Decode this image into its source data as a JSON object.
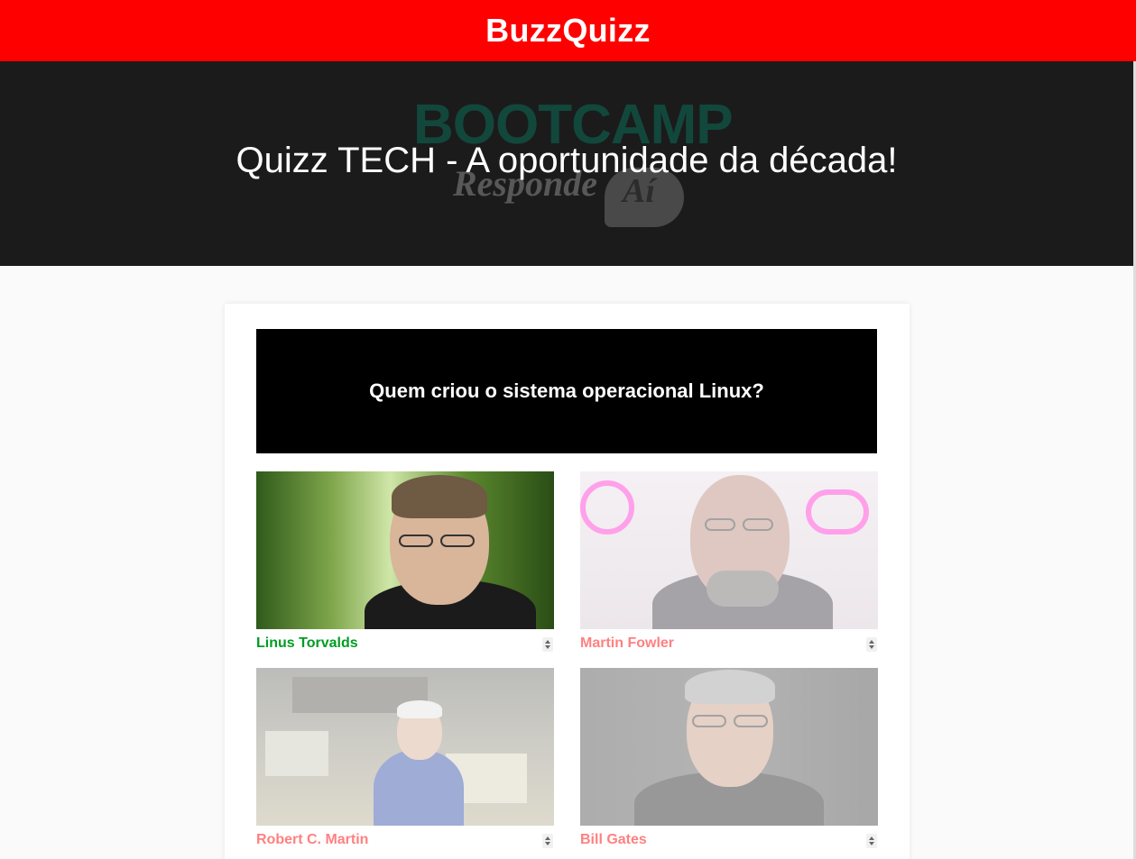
{
  "app": {
    "title": "BuzzQuizz"
  },
  "banner": {
    "title": "Quizz TECH - A oportunidade da década!",
    "background_text_1": "BOOTCAMP",
    "background_text_2": "Responde",
    "background_text_3": "Aí"
  },
  "question": {
    "text": "Quem criou o sistema operacional Linux?",
    "background": "#000000"
  },
  "options": [
    {
      "label": "Linus Torvalds",
      "state": "correct",
      "color": "#009c22"
    },
    {
      "label": "Martin Fowler",
      "state": "wrong",
      "color": "#ff4b4b"
    },
    {
      "label": "Robert C. Martin",
      "state": "wrong",
      "color": "#ff4b4b"
    },
    {
      "label": "Bill Gates",
      "state": "wrong",
      "color": "#ff4b4b"
    }
  ],
  "colors": {
    "brand": "#ff0000",
    "banner": "#1b1b1b",
    "correct": "#009c22",
    "wrong": "#ff4b4b"
  }
}
